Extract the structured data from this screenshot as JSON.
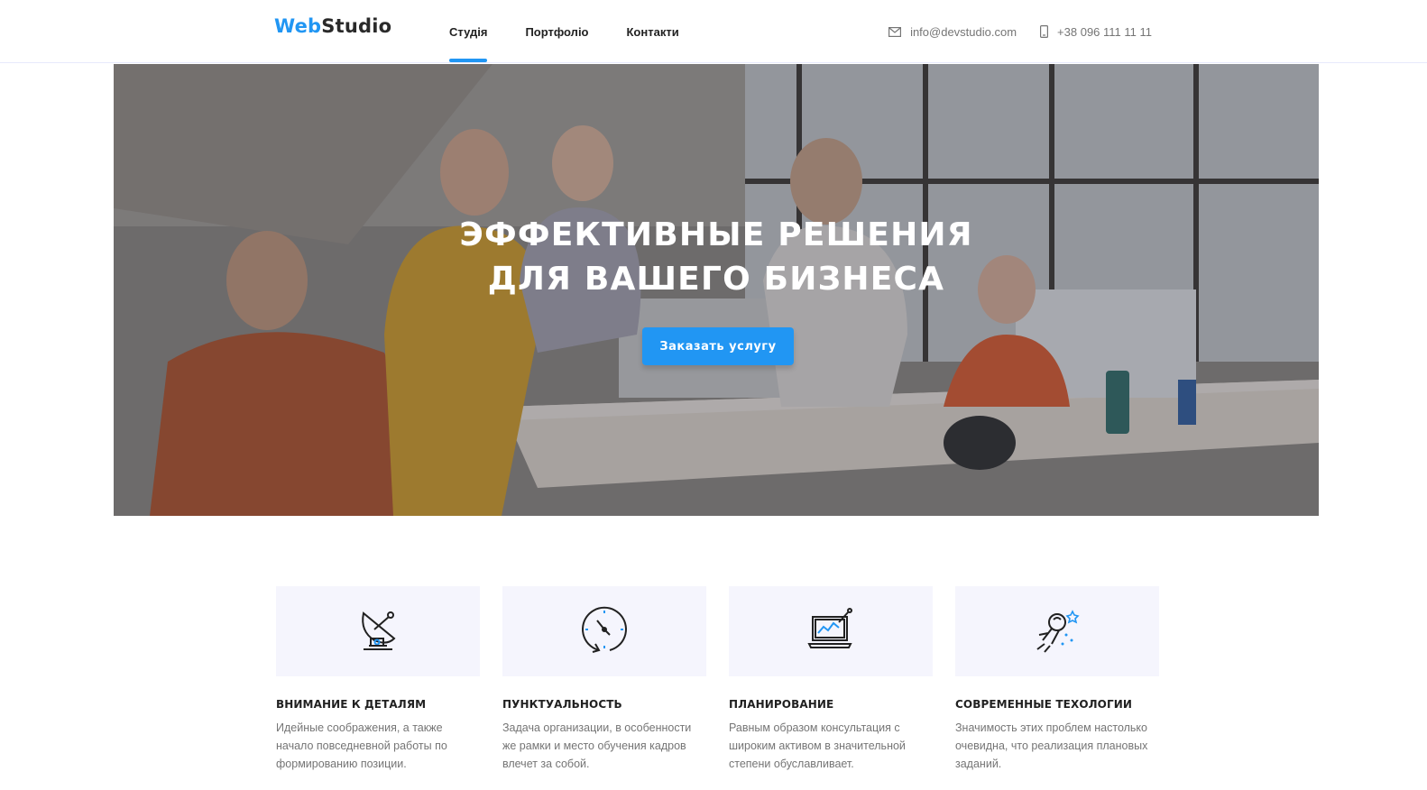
{
  "header": {
    "logo": {
      "part1": "Web",
      "part2": "Studio"
    },
    "nav": [
      {
        "label": "Студія",
        "active": true
      },
      {
        "label": "Портфоліо",
        "active": false
      },
      {
        "label": "Контакти",
        "active": false
      }
    ],
    "contacts": {
      "email": {
        "icon": "envelope-icon",
        "value": "info@devstudio.com"
      },
      "phone": {
        "icon": "phone-icon",
        "value": "+38 096 111 11 11"
      }
    }
  },
  "hero": {
    "title_line1": "Эффективные решения",
    "title_line2": "для вашего бизнеса",
    "cta": "Заказать услугу"
  },
  "features": [
    {
      "icon": "satellite-dish-icon",
      "title": "Внимание к деталям",
      "text": "Идейные соображения, а также начало повседневной работы по формированию позиции."
    },
    {
      "icon": "clock-icon",
      "title": "Пунктуальность",
      "text": "Задача организации, в особенности же рамки и место обучения кадров влечет за собой."
    },
    {
      "icon": "laptop-chart-icon",
      "title": "Планирование",
      "text": "Равным образом консультация с широким активом в значительной степени обуславливает."
    },
    {
      "icon": "astronaut-icon",
      "title": "Современные техологии",
      "text": "Значимость этих проблем настолько очевидна, что реализация плановых заданий."
    }
  ],
  "colors": {
    "accent": "#2196f3",
    "text": "#212121",
    "muted": "#757575",
    "featureBg": "#f5f5fd"
  }
}
